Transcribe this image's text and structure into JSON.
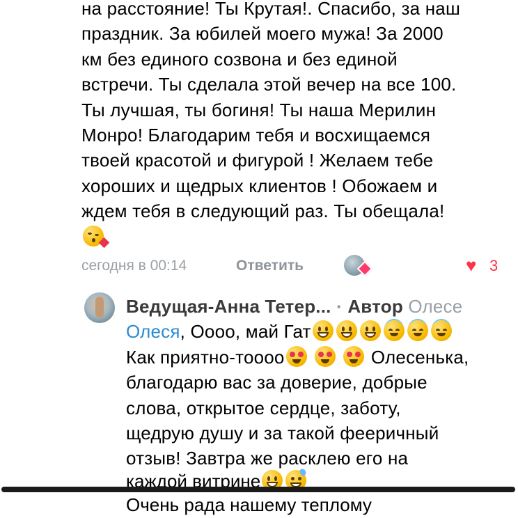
{
  "comment": {
    "lines": [
      "на расстояние! Ты Крутая!. Спасибо, за наш",
      "праздник. За юбилей моего мужа! За 2000",
      "км без единого созвона и без единой",
      "встречи. Ты сделала этой вечер на все 100.",
      "Ты лучшая, ты богиня! Ты наша  Мерилин",
      "Монро! Благодарим тебя и восхищаемся",
      "твоей красотой и фигурой ! Желаем тебе",
      "хороших и щедрых клиентов ! Обожаем и",
      "ждем тебя в следующий раз. Ты обещала!"
    ],
    "trailing_emoji": "face-blowing-kiss-icon",
    "timestamp": "сегодня в 00:14",
    "reply_label": "Ответить",
    "like_count": "3",
    "like_color": "#ff3347"
  },
  "reply": {
    "author": "Ведущая-Анна Тетер...",
    "separator": "·",
    "badge": "Автор",
    "reply_to": "Олесе",
    "mention": "Олеся",
    "first_line_text": ", Оооо, май Гат",
    "second_line_prefix": "Как приятно-тоооо",
    "second_line_suffix": "Олесенька,",
    "lines": [
      "благодарю вас за доверие, добрые",
      "слова, открытое сердце, заботу,",
      "щедрую душу и за такой фееричный",
      "отзыв! Завтра же расклею его на"
    ],
    "cut_line": "каждой витрине",
    "next_line": "Очень рада нашему теплому",
    "mention_color": "#2a8bd1"
  }
}
